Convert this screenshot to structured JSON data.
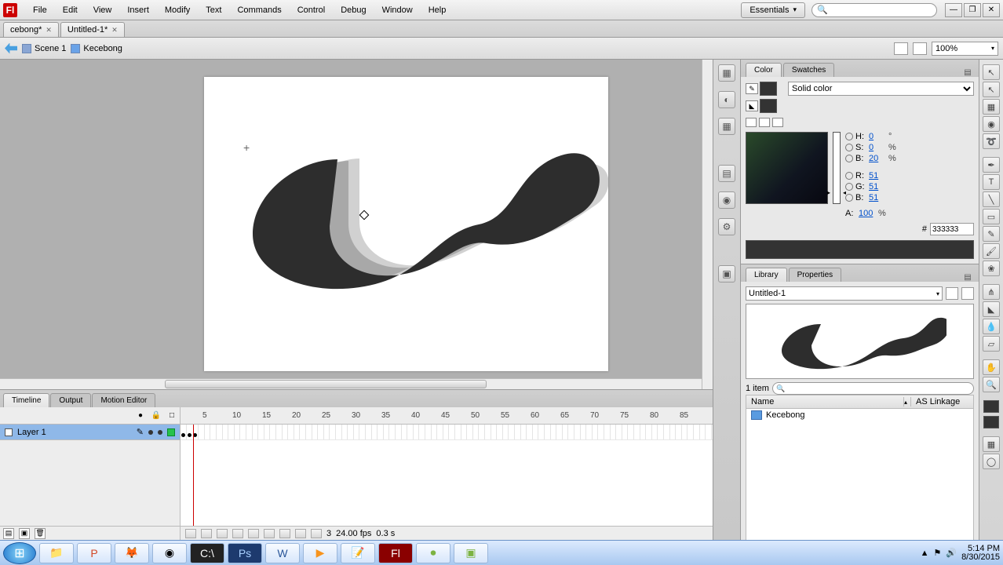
{
  "menu": {
    "file": "File",
    "edit": "Edit",
    "view": "View",
    "insert": "Insert",
    "modify": "Modify",
    "text": "Text",
    "commands": "Commands",
    "control": "Control",
    "debug": "Debug",
    "window": "Window",
    "help": "Help"
  },
  "workspace": "Essentials",
  "tabs": [
    {
      "label": "cebong*"
    },
    {
      "label": "Untitled-1*"
    }
  ],
  "breadcrumb": {
    "scene": "Scene 1",
    "symbol": "Kecebong"
  },
  "zoom": "100%",
  "timeline": {
    "tabs": [
      "Timeline",
      "Output",
      "Motion Editor"
    ],
    "layer": "Layer 1",
    "ticks": [
      "5",
      "10",
      "15",
      "20",
      "25",
      "30",
      "35",
      "40",
      "45",
      "50",
      "55",
      "60",
      "65",
      "70",
      "75",
      "80",
      "85"
    ],
    "frame": "3",
    "fps": "24.00 fps",
    "time": "0.3 s"
  },
  "color": {
    "tab1": "Color",
    "tab2": "Swatches",
    "filltype": "Solid color",
    "h": "0",
    "s": "0",
    "b": "20",
    "r": "51",
    "g": "51",
    "bl": "51",
    "hex": "333333",
    "a": "100"
  },
  "library": {
    "tab1": "Library",
    "tab2": "Properties",
    "doc": "Untitled-1",
    "count": "1 item",
    "h1": "Name",
    "h2": "AS Linkage",
    "item": "Kecebong"
  },
  "tray": {
    "time": "5:14 PM",
    "date": "8/30/2015"
  }
}
